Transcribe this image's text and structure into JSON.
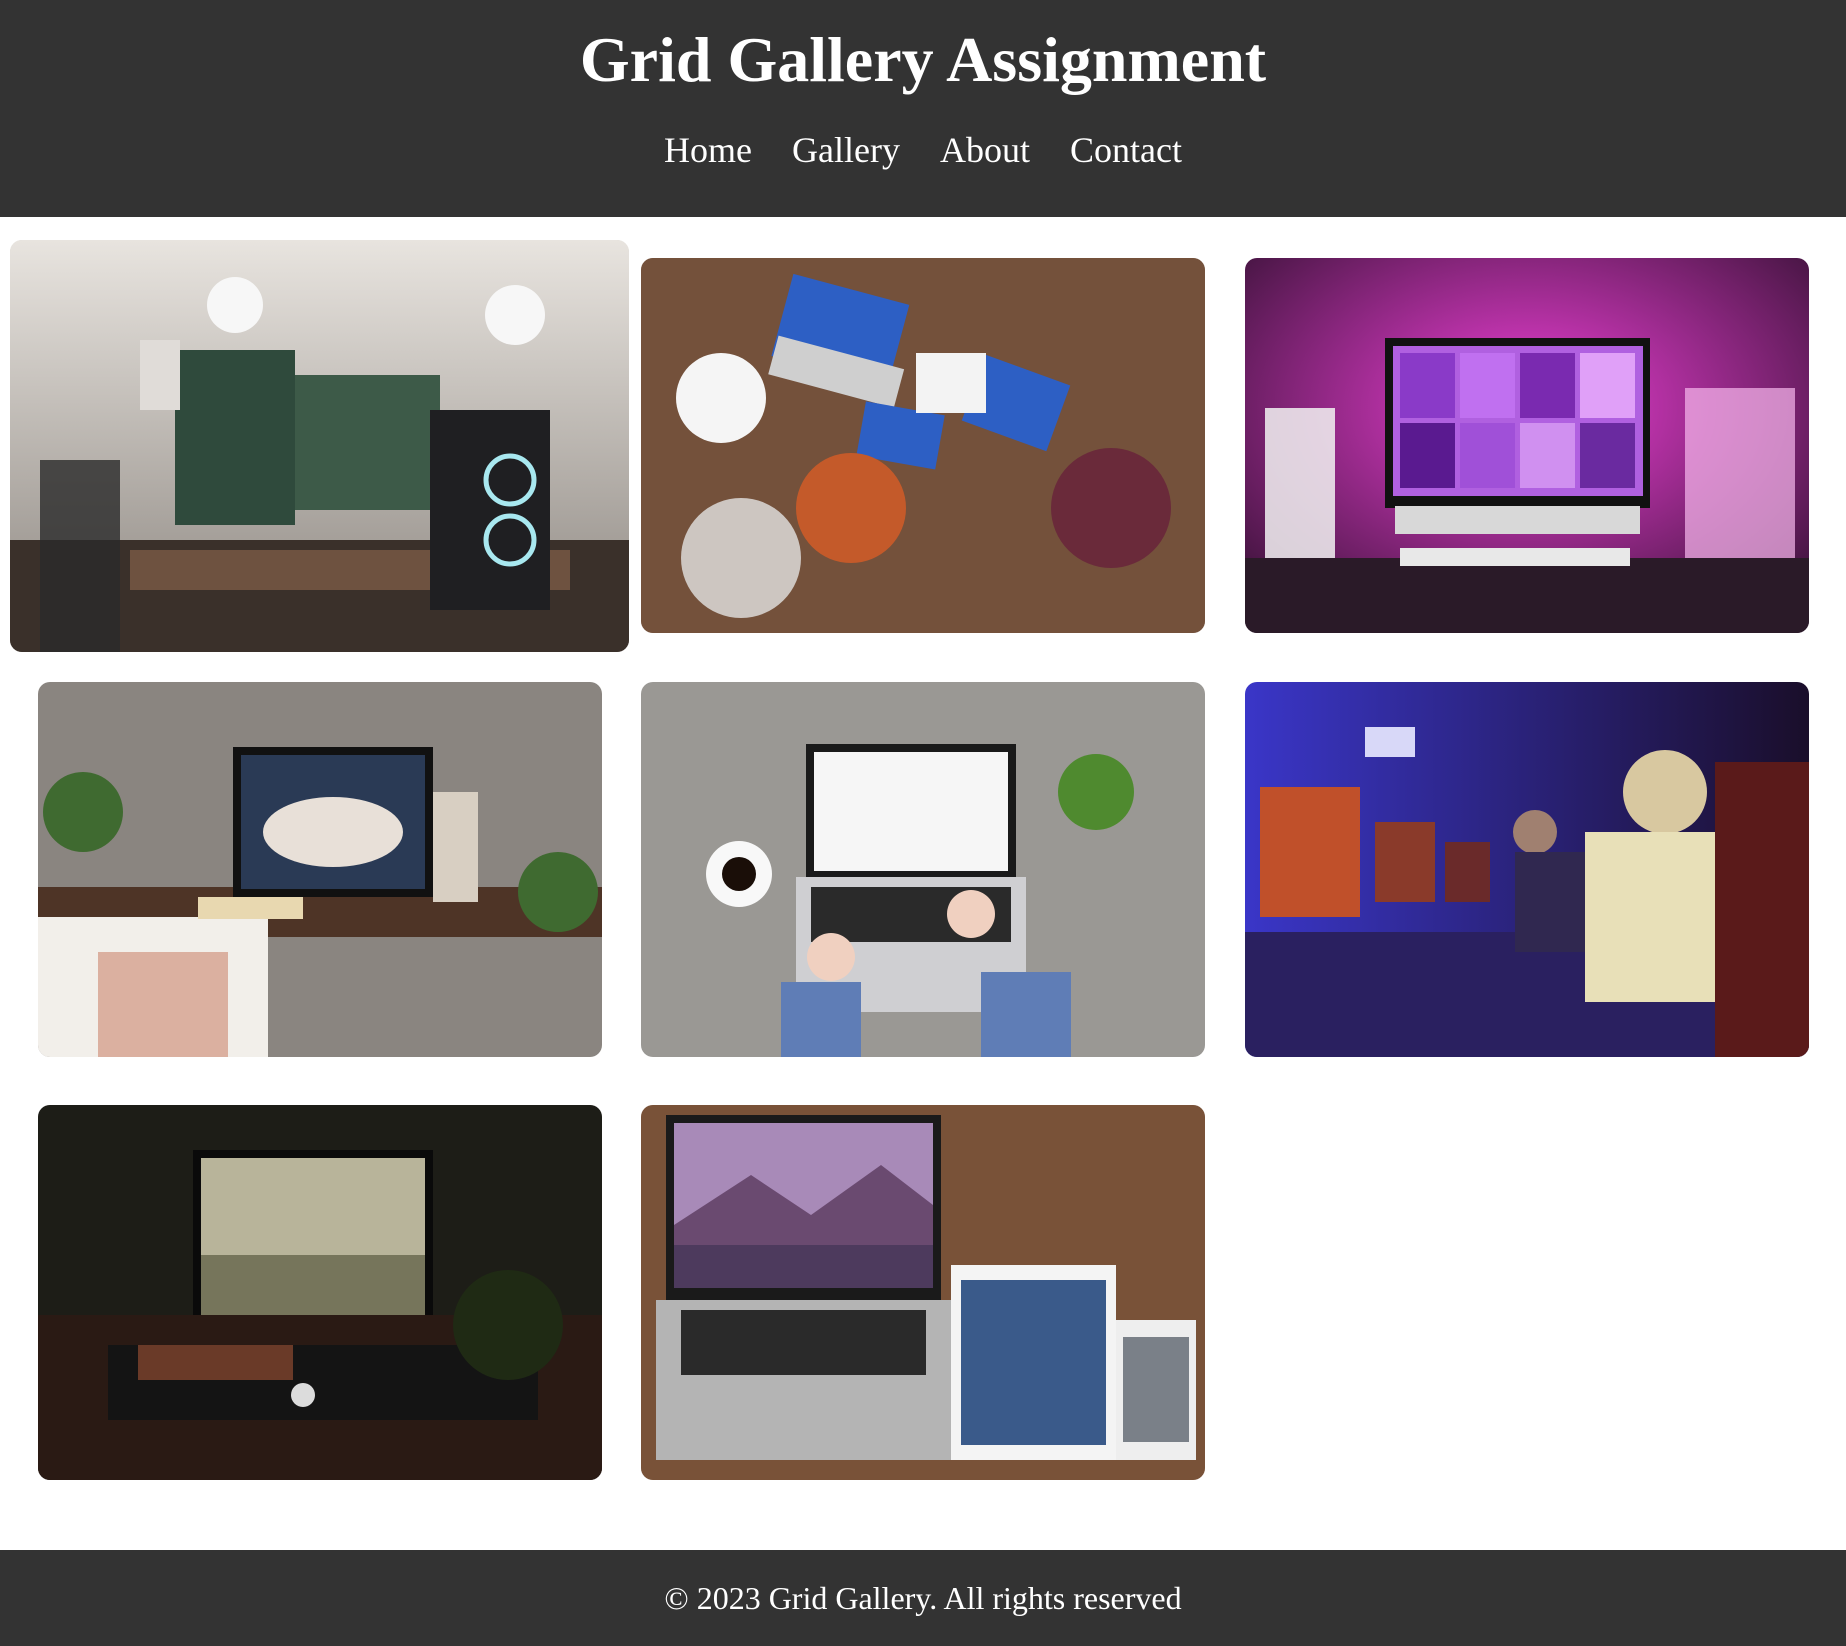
{
  "header": {
    "title": "Grid Gallery Assignment",
    "nav": [
      "Home",
      "Gallery",
      "About",
      "Contact"
    ]
  },
  "gallery": [
    {
      "subject": "gaming desk setup with two monitors, ring lights and PC tower",
      "palette": [
        "#d8d4cf",
        "#2f3a34",
        "#6e5a4a"
      ]
    },
    {
      "subject": "overhead view of team with laptops on wooden table",
      "palette": [
        "#6b4a35",
        "#d9d9d9",
        "#3b6cc9"
      ]
    },
    {
      "subject": "iMac on desk under pink neon light",
      "palette": [
        "#3a1838",
        "#e03ac8",
        "#f1f1f1"
      ]
    },
    {
      "subject": "desk with monitor, keyboard and plants against concrete wall",
      "palette": [
        "#8a8580",
        "#5a3c2c",
        "#f1ece6"
      ]
    },
    {
      "subject": "hands typing on laptop beside coffee cup and plant",
      "palette": [
        "#9c9c98",
        "#c8c8c8",
        "#5f7db6"
      ]
    },
    {
      "subject": "gamers at computers in neon esports arena",
      "palette": [
        "#1a1640",
        "#6b5be0",
        "#d0a070"
      ]
    },
    {
      "subject": "dark desk setup with monitor showing misty forest",
      "palette": [
        "#101210",
        "#c7c3a8",
        "#4a2c20"
      ]
    },
    {
      "subject": "laptop, tablet and phone on wooden desk",
      "palette": [
        "#6a4630",
        "#b0b0b0",
        "#a07090"
      ]
    }
  ],
  "footer": {
    "text": "© 2023 Grid Gallery. All rights reserved"
  }
}
